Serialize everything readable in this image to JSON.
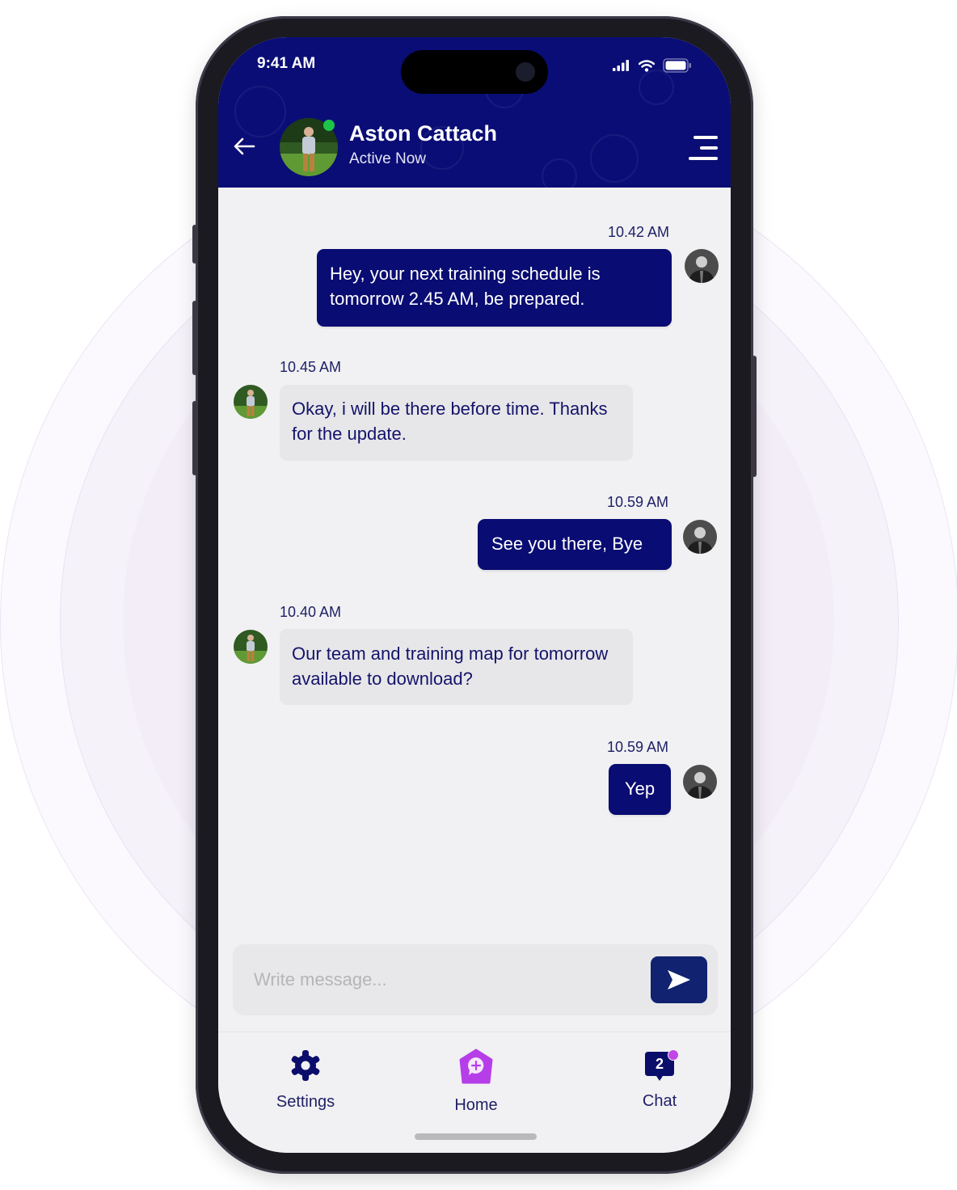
{
  "status_bar": {
    "time": "9:41 AM",
    "icons": [
      "cellular-signal-icon",
      "wifi-icon",
      "battery-icon"
    ]
  },
  "header": {
    "back_icon": "arrow-left-icon",
    "contact_name": "Aston Cattach",
    "presence": "Active Now",
    "online_indicator_color": "#1cc44a",
    "menu_icon": "hamburger-menu-icon",
    "background_color": "#0a0d75"
  },
  "messages": [
    {
      "direction": "outgoing",
      "time": "10.42 AM",
      "text": "Hey, your next training schedule is tomorrow 2.45 AM, be prepared."
    },
    {
      "direction": "incoming",
      "time": "10.45 AM",
      "text": "Okay, i will be there before time. Thanks for the update."
    },
    {
      "direction": "outgoing",
      "time": "10.59 AM",
      "text": "See you there, Bye"
    },
    {
      "direction": "incoming",
      "time": "10.40 AM",
      "text": "Our team and training map for tomorrow available to download?"
    },
    {
      "direction": "outgoing",
      "time": "10.59 AM",
      "text": "Yep"
    }
  ],
  "composer": {
    "placeholder": "Write message...",
    "value": "",
    "send_icon": "send-icon"
  },
  "tabbar": {
    "items": [
      {
        "label": "Settings",
        "icon": "gear-icon",
        "active": false
      },
      {
        "label": "Home",
        "icon": "home-chat-plus-icon",
        "active": true
      },
      {
        "label": "Chat",
        "icon": "chat-bubble-icon",
        "badge": "2",
        "active": false
      }
    ]
  },
  "colors": {
    "outgoing_bubble": "#090c72",
    "incoming_bubble": "#e7e7e9",
    "accent": "#b63ee8",
    "text_dark": "#14136b"
  }
}
